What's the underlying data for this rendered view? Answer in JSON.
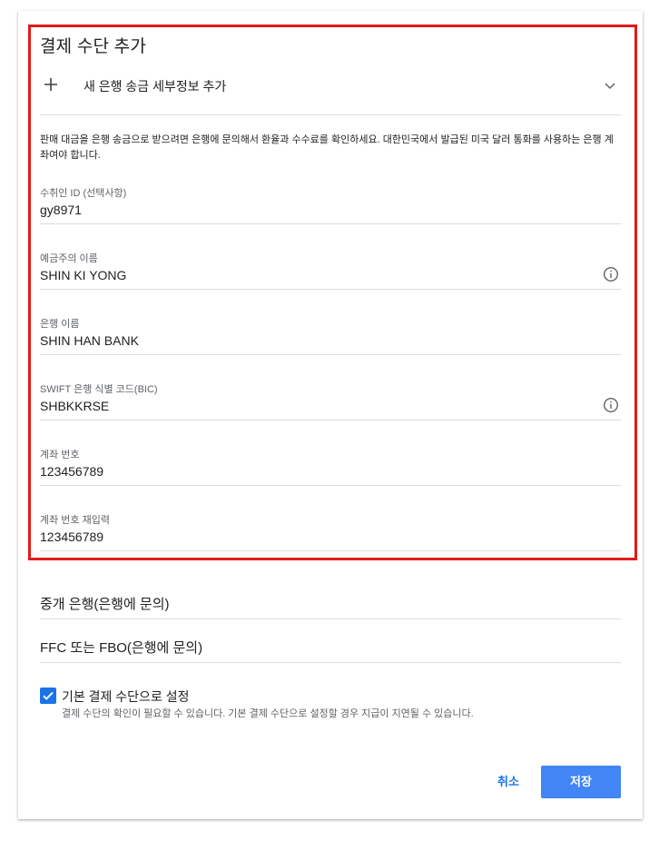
{
  "dialog": {
    "title": "결제 수단 추가",
    "add_bank_label": "새 은행 송금 세부정보 추가",
    "info_text": "판매 대금을 은행 송금으로 받으려면 은행에 문의해서 환율과 수수료를 확인하세요. 대한민국에서 발급된 미국 달러 통화를 사용하는 은행 계좌여야 합니다."
  },
  "fields": [
    {
      "label": "수취인 ID (선택사항)",
      "value": "gy8971"
    },
    {
      "label": "예금주의 이름",
      "value": "SHIN KI YONG",
      "info_icon": "info-icon"
    },
    {
      "label": "은행 이름",
      "value": "SHIN HAN BANK"
    },
    {
      "label": "SWIFT 은행 식별 코드(BIC)",
      "value": "SHBKKRSE",
      "info_icon": "info-icon"
    },
    {
      "label": "계좌 번호",
      "value": "123456789"
    },
    {
      "label": "계좌 번호 재입력",
      "value": "123456789"
    }
  ],
  "optional_fields": [
    {
      "placeholder": "중개 은행(은행에 문의)"
    },
    {
      "placeholder": "FFC 또는 FBO(은행에 문의)"
    }
  ],
  "default_option": {
    "checked": true,
    "label": "기본 결제 수단으로 설정",
    "description": "결제 수단의 확인이 필요할 수 있습니다. 기본 결제 수단으로 설정할 경우 지급이 지연될 수 있습니다."
  },
  "actions": {
    "cancel_label": "취소",
    "save_label": "저장"
  },
  "colors": {
    "accent": "#1a73e8",
    "save_button": "#4285f4",
    "highlight_border": "#e21a1a"
  },
  "icons": [
    "plus-icon",
    "chevron-down-icon",
    "info-icon",
    "checkmark-icon"
  ]
}
